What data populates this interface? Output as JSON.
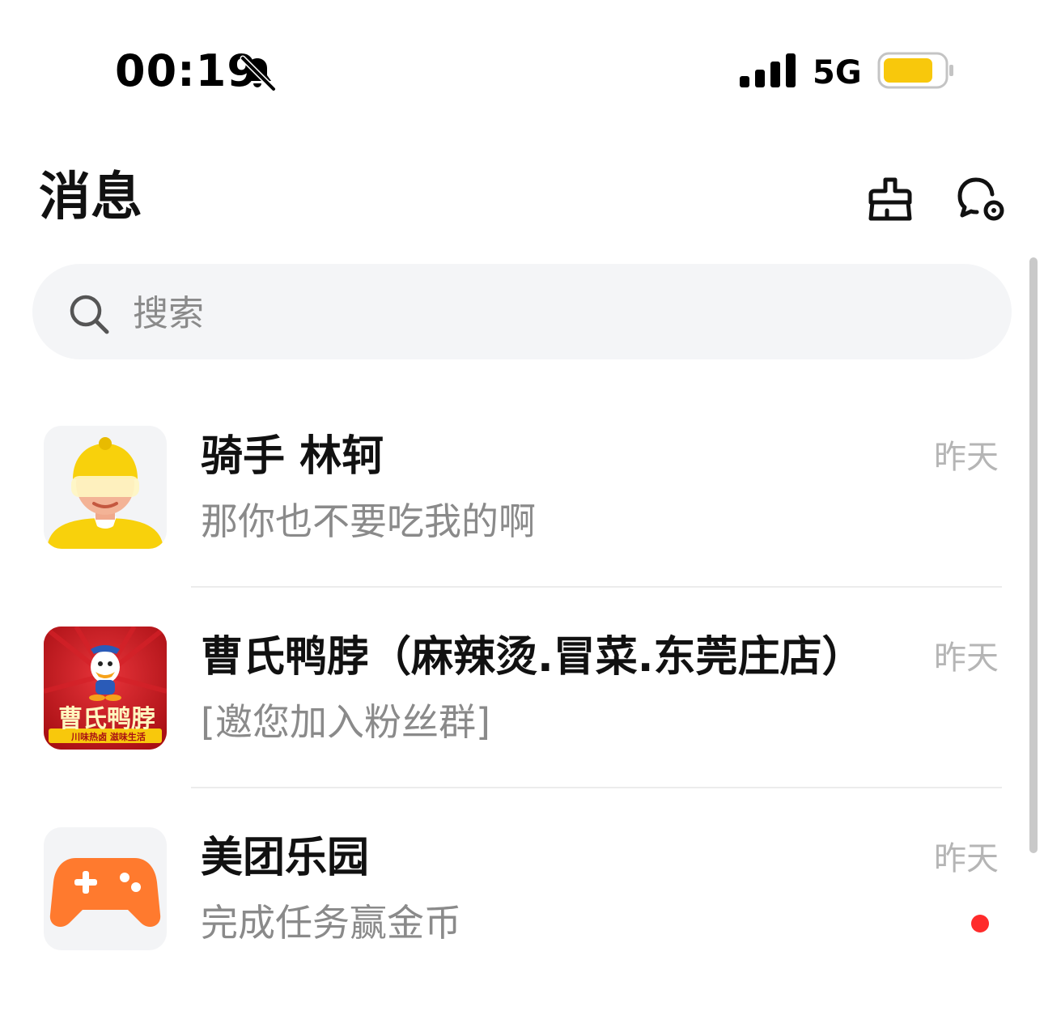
{
  "status_bar": {
    "time": "00:19",
    "network": "5G",
    "battery_color": "#f8c80c"
  },
  "header": {
    "title": "消息",
    "icons": [
      "broom-icon",
      "message-settings-icon"
    ]
  },
  "search": {
    "placeholder": "搜索"
  },
  "conversations": [
    {
      "name": "骑手 林轲",
      "message": "那你也不要吃我的啊",
      "time": "昨天",
      "avatar": "rider-avatar-icon"
    },
    {
      "name": "曹氏鸭脖（麻辣烫.冒菜.东莞庄店）",
      "message": "[邀您加入粉丝群]",
      "time": "昨天",
      "avatar": "caoshi-logo",
      "logo_text": "曹氏鸭脖",
      "logo_subtext": "川味热卤 滋味生活"
    },
    {
      "name": "美团乐园",
      "message": "完成任务赢金币",
      "time": "昨天",
      "avatar": "gamepad-icon",
      "unread": true
    }
  ],
  "colors": {
    "accent_yellow": "#f8c80c",
    "game_orange": "#ff7a2e",
    "logo_red": "#c8181e",
    "unread_red": "#ff2b2b"
  }
}
